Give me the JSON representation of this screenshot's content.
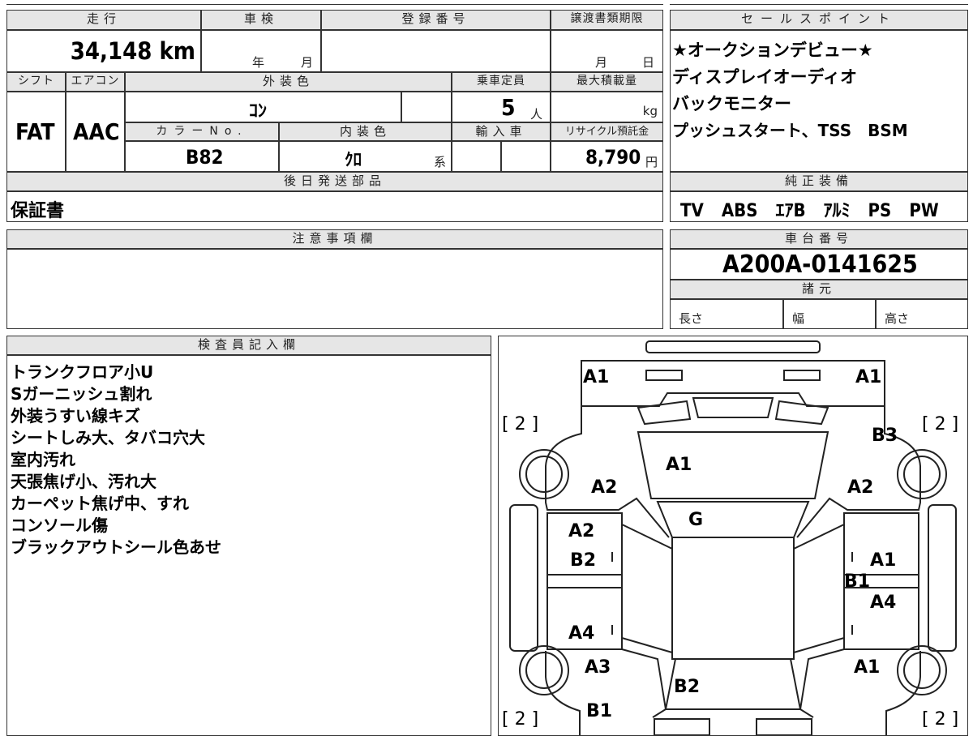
{
  "mileage": {
    "header": "走行",
    "value": "34,148 km"
  },
  "inspection": {
    "header": "車検",
    "year_unit": "年",
    "month_unit": "月"
  },
  "registration": {
    "header": "登録番号"
  },
  "transfer_deadline": {
    "header": "譲渡書類期限",
    "month_unit": "月",
    "day_unit": "日"
  },
  "shift": {
    "header": "シフト",
    "value": "FAT"
  },
  "aircon": {
    "header": "エアコン",
    "value": "AAC"
  },
  "exterior_color": {
    "header": "外装色",
    "value": "ｺﾝ"
  },
  "capacity": {
    "header": "乗車定員",
    "value": "5",
    "unit": "人"
  },
  "max_load": {
    "header": "最大積載量",
    "unit": "kg"
  },
  "color_no": {
    "header": "カラーNo.",
    "value": "B82"
  },
  "interior_color": {
    "header": "内装色",
    "value": "ｸﾛ",
    "unit": "系"
  },
  "import": {
    "header": "輸入車"
  },
  "recycle": {
    "header": "リサイクル預託金",
    "value": "8,790",
    "unit": "円"
  },
  "later_parts": {
    "header": "後日発送部品",
    "value": "保証書"
  },
  "sales_points": {
    "header": "セールスポイント",
    "lines": [
      "★オークションデビュー★",
      "ディスプレイオーディオ",
      "バックモニター",
      "プッシュスタート、TSS　BSM"
    ]
  },
  "equipment": {
    "header": "純正装備",
    "value": "TV　ABS　ｴｱB　ｱﾙﾐ　PS　PW"
  },
  "caution": {
    "header": "注意事項欄"
  },
  "chassis": {
    "header": "車台番号",
    "value": "A200A-0141625"
  },
  "specs": {
    "header": "諸元",
    "length": "長さ",
    "width": "幅",
    "height": "高さ"
  },
  "inspector": {
    "header": "検査員記入欄",
    "notes": [
      "トランクフロア小U",
      "Sガーニッシュ割れ",
      "外装うすい線キズ",
      "シートしみ大、タバコ穴大",
      "室内汚れ",
      "天張焦げ小、汚れ大",
      "カーペット焦げ中、すれ",
      "コンソール傷",
      "ブラックアウトシール色あせ"
    ]
  },
  "diagram": {
    "labels": [
      {
        "id": "a1-front-left",
        "text": "A1"
      },
      {
        "id": "a1-front-right",
        "text": "A1"
      },
      {
        "id": "bracket-tl",
        "text": "[ 2 ]"
      },
      {
        "id": "bracket-tr",
        "text": "[ 2 ]"
      },
      {
        "id": "b3-right",
        "text": "B3"
      },
      {
        "id": "a1-hood",
        "text": "A1"
      },
      {
        "id": "a2-fender-left",
        "text": "A2"
      },
      {
        "id": "a2-fender-right",
        "text": "A2"
      },
      {
        "id": "g-windshield",
        "text": "G"
      },
      {
        "id": "a2-door-left",
        "text": "A2"
      },
      {
        "id": "b2-door-left",
        "text": "B2"
      },
      {
        "id": "a1-door-right",
        "text": "A1"
      },
      {
        "id": "b1-door-right",
        "text": "B1"
      },
      {
        "id": "a4-door-right",
        "text": "A4"
      },
      {
        "id": "a4-rear-door-left",
        "text": "A4"
      },
      {
        "id": "a3-quarter-left",
        "text": "A3"
      },
      {
        "id": "a1-quarter-right",
        "text": "A1"
      },
      {
        "id": "b2-rear",
        "text": "B2"
      },
      {
        "id": "b1-rear-left",
        "text": "B1"
      },
      {
        "id": "bracket-bl",
        "text": "[ 2 ]"
      },
      {
        "id": "bracket-br",
        "text": "[ 2 ]"
      }
    ]
  }
}
